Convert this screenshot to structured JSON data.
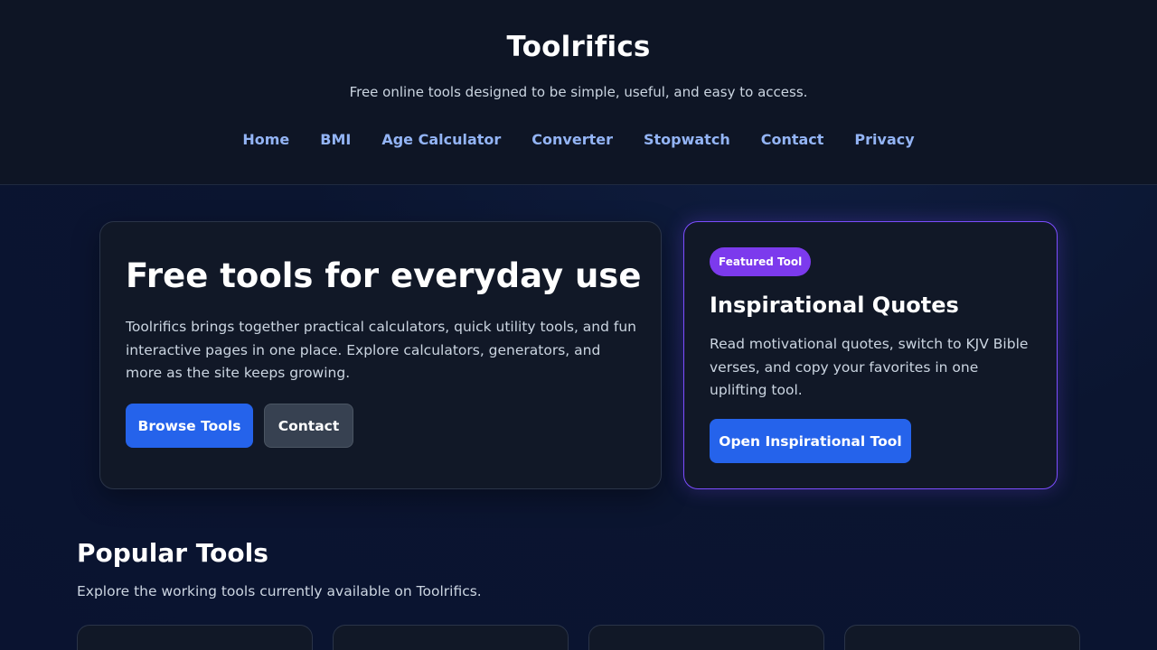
{
  "header": {
    "title": "Toolrifics",
    "tagline": "Free online tools designed to be simple, useful, and easy to access."
  },
  "nav": {
    "items": [
      {
        "label": "Home"
      },
      {
        "label": "BMI"
      },
      {
        "label": "Age Calculator"
      },
      {
        "label": "Converter"
      },
      {
        "label": "Stopwatch"
      },
      {
        "label": "Contact"
      },
      {
        "label": "Privacy"
      }
    ]
  },
  "hero": {
    "title": "Free tools for everyday use",
    "description": "Toolrifics brings together practical calculators, quick utility tools, and fun interactive pages in one place. Explore calculators, generators, and more as the site keeps growing.",
    "browse_label": "Browse Tools",
    "contact_label": "Contact"
  },
  "featured": {
    "badge": "Featured Tool",
    "title": "Inspirational Quotes",
    "description": "Read motivational quotes, switch to KJV Bible verses, and copy your favorites in one uplifting tool.",
    "button_label": "Open Inspirational Tool"
  },
  "popular": {
    "title": "Popular Tools",
    "subtitle": "Explore the working tools currently available on Toolrifics."
  },
  "colors": {
    "accent": "#2563eb",
    "badge": "#7c3aed",
    "nav_link": "#93b4f5"
  }
}
